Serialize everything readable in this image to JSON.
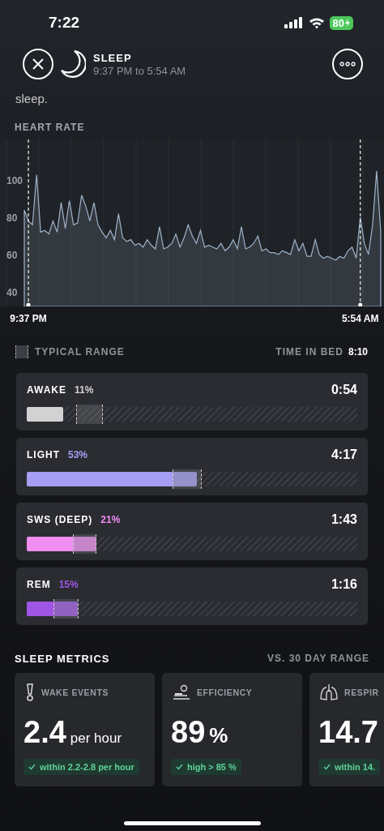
{
  "status_bar": {
    "time": "7:22",
    "battery": "80"
  },
  "header": {
    "title": "SLEEP",
    "subtitle": "9:37 PM to 5:54 AM"
  },
  "intro_text": "sleep.",
  "heart_rate": {
    "title": "HEART RATE",
    "chart_data": {
      "type": "area",
      "grid": true,
      "ylim": [
        32,
        122
      ],
      "yticks": [
        40,
        60,
        80,
        100
      ],
      "categories": [
        null,
        "9:37 PM",
        null,
        null,
        null,
        null,
        null,
        null,
        null,
        null,
        null,
        null,
        null,
        null,
        null,
        null,
        null,
        null,
        null,
        null,
        null,
        null,
        null,
        null,
        null,
        null,
        null,
        null,
        null,
        null,
        null,
        null,
        null,
        null,
        null,
        null,
        null,
        null,
        null,
        null,
        null,
        null,
        null,
        null,
        null,
        null,
        null,
        null,
        null,
        null,
        null,
        null,
        null,
        null,
        null,
        null,
        null,
        null,
        null,
        null,
        null,
        null,
        null,
        null,
        null,
        null,
        null,
        null,
        null,
        null,
        null,
        null,
        null,
        null,
        null,
        null,
        null,
        null,
        null,
        null,
        null,
        null,
        "5:54 AM",
        null,
        null,
        null,
        null,
        null
      ],
      "series": [
        {
          "color": "#9fb3c8",
          "values": [
            84,
            78,
            76,
            103,
            72,
            73,
            71,
            78,
            72,
            88,
            74,
            89,
            76,
            77,
            92,
            86,
            78,
            88,
            76,
            72,
            69,
            73,
            68,
            82,
            69,
            67,
            68,
            65,
            66,
            64,
            68,
            65,
            63,
            75,
            63,
            64,
            66,
            71,
            64,
            69,
            76,
            70,
            66,
            73,
            64,
            65,
            64,
            63,
            66,
            62,
            64,
            68,
            63,
            75,
            63,
            64,
            66,
            70,
            62,
            63,
            61,
            61,
            60,
            62,
            61,
            60,
            68,
            62,
            66,
            59,
            59,
            68,
            60,
            58,
            59,
            58,
            57,
            59,
            58,
            62,
            64,
            58,
            80,
            66,
            60,
            76,
            105,
            72
          ]
        }
      ]
    }
  },
  "legend": {
    "label": "TYPICAL RANGE",
    "time_in_bed_label": "TIME IN BED",
    "time_in_bed": "8:10"
  },
  "stages": [
    {
      "name": "AWAKE",
      "percent": "11%",
      "duration": "0:54",
      "color": "#d2d2d2",
      "level": 0.11,
      "typical_range": {
        "from": {
          "level": 0.15
        },
        "to": {
          "level": 0.23
        }
      }
    },
    {
      "name": "LIGHT",
      "percent": "53%",
      "duration": "4:17",
      "color": "#a59ef2",
      "level": 0.515,
      "typical_range": {
        "from": {
          "level": 0.44
        },
        "to": {
          "level": 0.53
        }
      }
    },
    {
      "name": "SWS (DEEP)",
      "percent": "21%",
      "duration": "1:43",
      "color": "#ef8df0",
      "level": 0.21,
      "typical_range": {
        "from": {
          "level": 0.14
        },
        "to": {
          "level": 0.21
        }
      }
    },
    {
      "name": "REM",
      "percent": "15%",
      "duration": "1:16",
      "color": "#a056e4",
      "level": 0.155,
      "typical_range": {
        "from": {
          "level": 0.08
        },
        "to": {
          "level": 0.157
        }
      }
    }
  ],
  "metrics": {
    "title": "SLEEP METRICS",
    "range_label": "VS. 30 DAY RANGE",
    "cards": [
      {
        "kind": "alert",
        "label": "WAKE EVENTS",
        "value": "2.4",
        "unit": "per hour",
        "note": "within 2.2-2.8 per hour"
      },
      {
        "kind": "bed",
        "label": "EFFICIENCY",
        "value": "89",
        "unit": "%",
        "note": "high > 85 %"
      },
      {
        "kind": "lungs",
        "label": "RESPIR",
        "value": "14.7",
        "note": "within 14."
      }
    ]
  }
}
